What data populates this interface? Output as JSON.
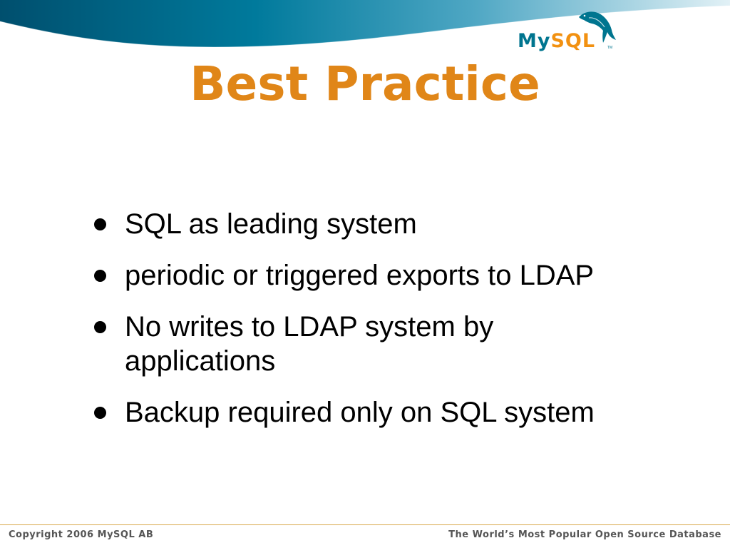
{
  "slide": {
    "title": "Best Practice",
    "bullets": [
      "SQL as leading system",
      "periodic or triggered exports to LDAP",
      "No writes to LDAP system by applications",
      "Backup required only on SQL system"
    ]
  },
  "logo": {
    "my": "My",
    "sql": "SQL",
    "tm": "TM",
    "icon": "dolphin-icon"
  },
  "footer": {
    "copyright": "Copyright 2006 MySQL AB",
    "tagline": "The World’s Most Popular Open Source Database"
  },
  "colors": {
    "title": "#e08618",
    "banner_dark": "#006f8e",
    "banner_light": "#d8eef4",
    "logo_blue": "#00758f",
    "logo_orange": "#f29111",
    "footer_text": "#555555",
    "footer_line": "#d8a94a"
  }
}
